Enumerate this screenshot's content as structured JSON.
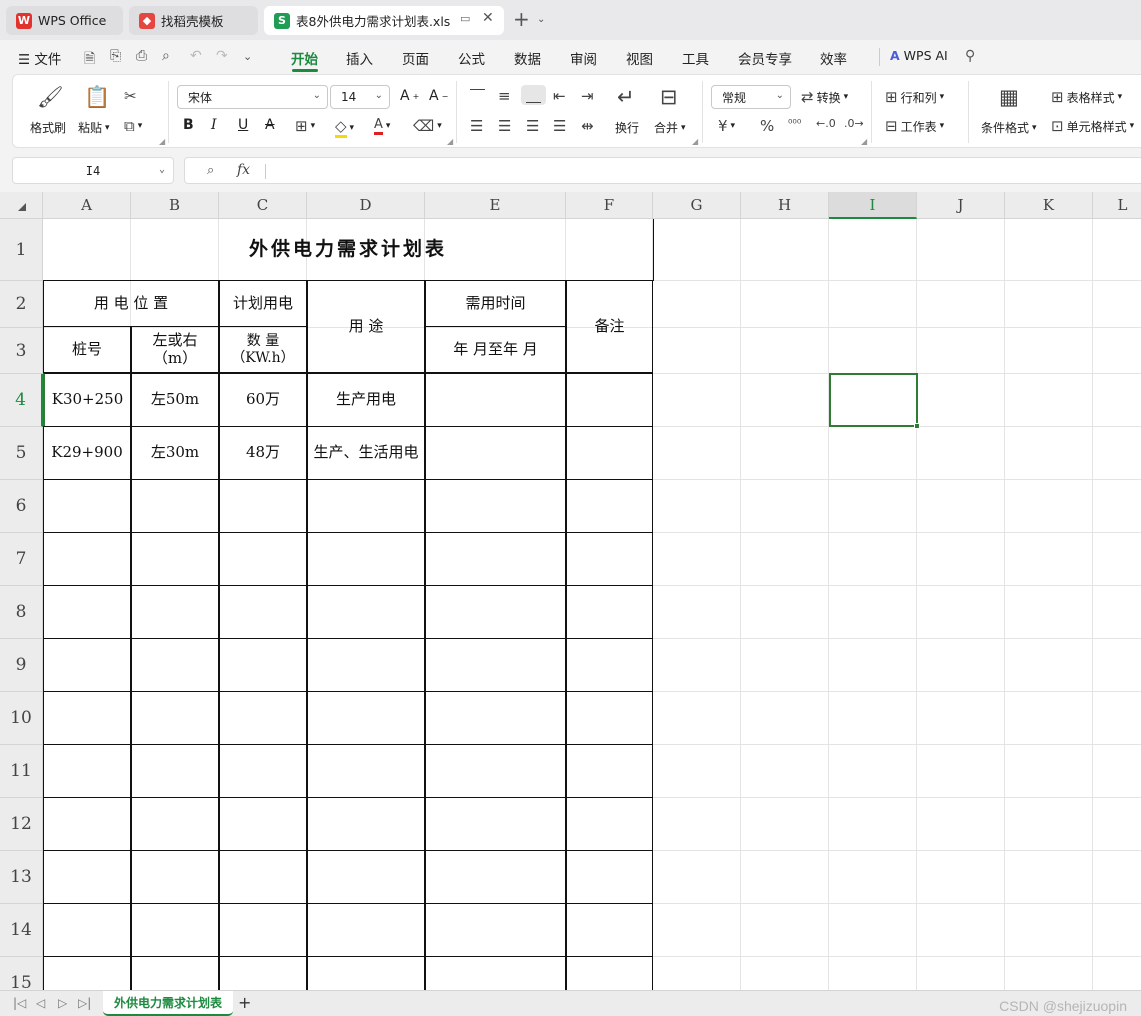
{
  "tabs": [
    {
      "label": "WPS Office",
      "icon": "wps-logo-icon"
    },
    {
      "label": "找稻壳模板",
      "icon": "docer-icon"
    },
    {
      "label": "表8外供电力需求计划表.xls",
      "icon": "spreadsheet-icon"
    }
  ],
  "menu": {
    "file": "文件",
    "items": [
      "开始",
      "插入",
      "页面",
      "公式",
      "数据",
      "审阅",
      "视图",
      "工具",
      "会员专享",
      "效率"
    ],
    "active": "开始",
    "ai": "WPS AI"
  },
  "ribbon": {
    "format_painter": "格式刷",
    "paste": "粘贴",
    "font_name": "宋体",
    "font_size": "14",
    "wrap": "换行",
    "merge": "合并",
    "number_format": "常规",
    "convert": "转换",
    "rows_cols": "行和列",
    "worksheet": "工作表",
    "conditional_format": "条件格式",
    "table_style": "表格样式",
    "cell_style": "单元格样式"
  },
  "formula_bar": {
    "cell_ref": "I4",
    "fx": "fx",
    "content": ""
  },
  "grid": {
    "columns": [
      "A",
      "B",
      "C",
      "D",
      "E",
      "F",
      "G",
      "H",
      "I",
      "J",
      "K",
      "L"
    ],
    "rows": [
      "1",
      "2",
      "3",
      "4",
      "5",
      "6",
      "7",
      "8",
      "9",
      "10",
      "11",
      "12",
      "13",
      "14",
      "15"
    ],
    "selected_column": "I",
    "selected_row": "4"
  },
  "sheet": {
    "title": "外供电力需求计划表",
    "header": {
      "location": "用 电 位 置",
      "planned": "计划用电",
      "usage": "用  途",
      "time": "需用时间",
      "note": "备注",
      "stake": "桩号",
      "side": "左或右\n（m）",
      "quantity": "数  量\n（KW.h）",
      "period": "年  月至年  月"
    },
    "rows": [
      [
        "K30+250",
        "左50m",
        "60万",
        "生产用电",
        "",
        ""
      ],
      [
        "K29+900",
        "左30m",
        "48万",
        "生产、生活用电",
        "",
        ""
      ]
    ]
  },
  "sheet_tabs": {
    "active": "外供电力需求计划表"
  },
  "watermark": "CSDN @shejizuopin"
}
